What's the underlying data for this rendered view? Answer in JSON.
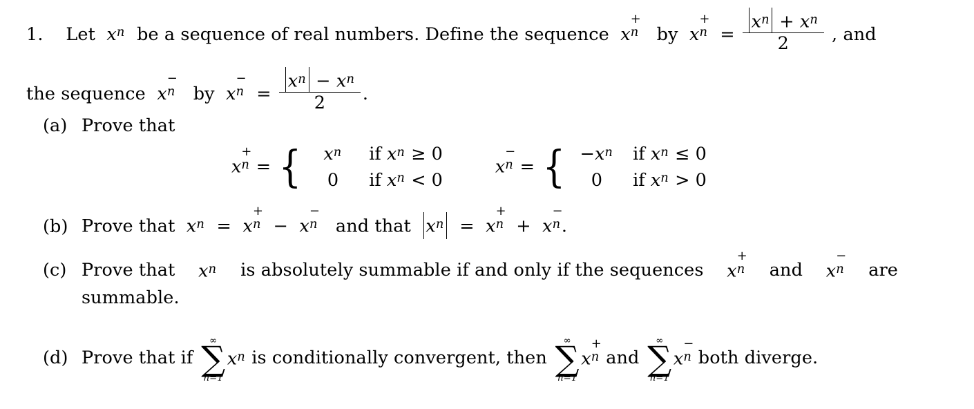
{
  "document": {
    "problem_number": "1.",
    "stem": {
      "line1_part1": "Let",
      "line1_var_base": "x",
      "line1_var_sub": "n",
      "line1_part2": "be a sequence of real numbers.  Define the sequence",
      "line1_part3": "by",
      "equals": "=",
      "fraction1_numerator_abs": "x",
      "fraction1_numerator_abs_sub": "n",
      "fraction1_numerator_op": "+",
      "fraction1_numerator_term": "x",
      "fraction1_numerator_term_sub": "n",
      "fraction1_denominator": "2",
      "line1_tail": ", and",
      "line2_part1": "the sequence",
      "line2_part2": "by",
      "fraction2_numerator_op": "−",
      "fraction2_denominator": "2",
      "line2_tail": "."
    },
    "items": [
      {
        "label": "(a)",
        "text": "Prove that",
        "display": {
          "left": {
            "lhs_base": "x",
            "lhs_sup": "+",
            "lhs_sub": "n",
            "equals": "=",
            "rows": [
              {
                "value": "x",
                "value_sub": "n",
                "condition_prefix": "if",
                "condition_var": "x",
                "condition_sub": "n",
                "relation": "≥",
                "condition_value": "0"
              },
              {
                "value": "0",
                "value_sub": "",
                "condition_prefix": "if",
                "condition_var": "x",
                "condition_sub": "n",
                "relation": "<",
                "condition_value": "0"
              }
            ]
          },
          "right": {
            "lhs_base": "x",
            "lhs_sup": "−",
            "lhs_sub": "n",
            "equals": "=",
            "rows": [
              {
                "value": "−x",
                "value_sub": "n",
                "condition_prefix": "if",
                "condition_var": "x",
                "condition_sub": "n",
                "relation": "≤",
                "condition_value": "0"
              },
              {
                "value": "0",
                "value_sub": "",
                "condition_prefix": "if",
                "condition_var": "x",
                "condition_sub": "n",
                "relation": ">",
                "condition_value": "0"
              }
            ]
          }
        }
      },
      {
        "label": "(b)",
        "text_1": "Prove that",
        "text_2": "and that",
        "eq1_lhs": "x",
        "eq1_lhs_sub": "n",
        "eq1_equals": "=",
        "eq1_op": "−",
        "eq2_equals": "=",
        "eq2_op": "+",
        "tail": "."
      },
      {
        "label": "(c)",
        "text_1": "Prove  that",
        "text_2": "is  absolutely  summable  if  and  only  if  the  sequences",
        "text_3": "and",
        "text_4": "are",
        "text_5": "summable."
      },
      {
        "label": "(d)",
        "text_1": "Prove that if",
        "text_2": "is conditionally convergent, then",
        "text_3": "and",
        "text_4": "both diverge.",
        "sum_upper": "∞",
        "sum_lower": "n=1",
        "sigma": "∑"
      }
    ],
    "symbols": {
      "var": "x",
      "sub_n": "n",
      "plus": "+",
      "minus": "−"
    },
    "colors": {
      "ink": "#000000",
      "paper": "#ffffff"
    }
  }
}
